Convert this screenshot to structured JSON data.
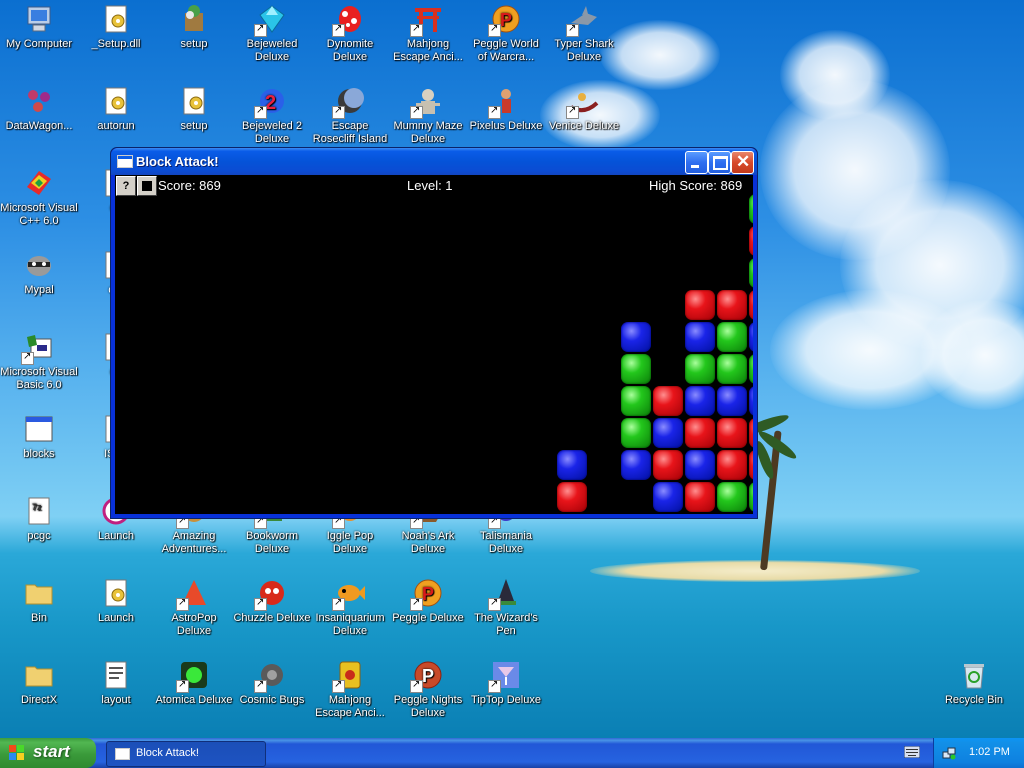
{
  "desktop": {
    "icons": [
      {
        "label": "My Computer",
        "icon": "computer"
      },
      {
        "label": "_Setup.dll",
        "icon": "gear-file"
      },
      {
        "label": "setup",
        "icon": "setup"
      },
      {
        "label": "Bejeweled Deluxe",
        "icon": "gem"
      },
      {
        "label": "Dynomite Deluxe",
        "icon": "egg"
      },
      {
        "label": "Mahjong Escape Anci...",
        "icon": "gate"
      },
      {
        "label": "Peggle World of Warcra...",
        "icon": "peggle"
      },
      {
        "label": "Typer Shark Deluxe",
        "icon": "shark"
      },
      {
        "label": "DataWagon...",
        "icon": "molecule"
      },
      {
        "label": "autorun",
        "icon": "gear-file"
      },
      {
        "label": "setup",
        "icon": "gear-file"
      },
      {
        "label": "Bejeweled 2 Deluxe",
        "icon": "gem-2"
      },
      {
        "label": "Escape Rosecliff Island",
        "icon": "moon"
      },
      {
        "label": "Mummy Maze Deluxe",
        "icon": "mummy"
      },
      {
        "label": "Pixelus Deluxe",
        "icon": "pixelus"
      },
      {
        "label": "Venice Deluxe",
        "icon": "gondola"
      },
      {
        "label": "Microsoft Visual C++ 6.0",
        "icon": "vcpp"
      },
      {
        "label": "da",
        "icon": "doc"
      },
      {
        "label": "Mypal",
        "icon": "raccoon"
      },
      {
        "label": "dat",
        "icon": "doc"
      },
      {
        "label": "Microsoft Visual Basic 6.0",
        "icon": "vb"
      },
      {
        "label": "da",
        "icon": "doc"
      },
      {
        "label": "blocks",
        "icon": "window"
      },
      {
        "label": "ISSe",
        "icon": "doc"
      },
      {
        "label": "pcgc",
        "icon": "zip"
      },
      {
        "label": "Launch",
        "icon": "launch"
      },
      {
        "label": "Amazing Adventures...",
        "icon": "adventure"
      },
      {
        "label": "Bookworm Deluxe",
        "icon": "bookworm"
      },
      {
        "label": "Iggle Pop Deluxe",
        "icon": "iggle"
      },
      {
        "label": "Noah's Ark Deluxe",
        "icon": "ark"
      },
      {
        "label": "Talismania Deluxe",
        "icon": "talisman"
      },
      {
        "label": "Bin",
        "icon": "folder"
      },
      {
        "label": "Launch",
        "icon": "gear-file"
      },
      {
        "label": "AstroPop Deluxe",
        "icon": "astropop"
      },
      {
        "label": "Chuzzle Deluxe",
        "icon": "chuzzle"
      },
      {
        "label": "Insaniquarium Deluxe",
        "icon": "fish"
      },
      {
        "label": "Peggle Deluxe",
        "icon": "peggle"
      },
      {
        "label": "The Wizard's Pen",
        "icon": "wizard"
      },
      {
        "label": "DirectX",
        "icon": "folder"
      },
      {
        "label": "layout",
        "icon": "notepad"
      },
      {
        "label": "Atomica Deluxe",
        "icon": "atomica"
      },
      {
        "label": "Cosmic Bugs",
        "icon": "bug"
      },
      {
        "label": "Mahjong Escape Anci...",
        "icon": "mahjong"
      },
      {
        "label": "Peggle Nights Deluxe",
        "icon": "peggle"
      },
      {
        "label": "TipTop Deluxe",
        "icon": "cocktail"
      },
      {
        "label": "Recycle Bin",
        "icon": "recycle"
      }
    ]
  },
  "window": {
    "title": "Block Attack!",
    "help_label": "?",
    "score_text": "Score: 869",
    "level_text": "Level: 1",
    "high_score_text": "High Score: 869",
    "colors": {
      "red": "#e8141a",
      "blue": "#1a24e8",
      "green": "#23c71c"
    }
  },
  "taskbar": {
    "start_label": "start",
    "task_button_label": "Block Attack!",
    "clock": "1:02 PM"
  }
}
